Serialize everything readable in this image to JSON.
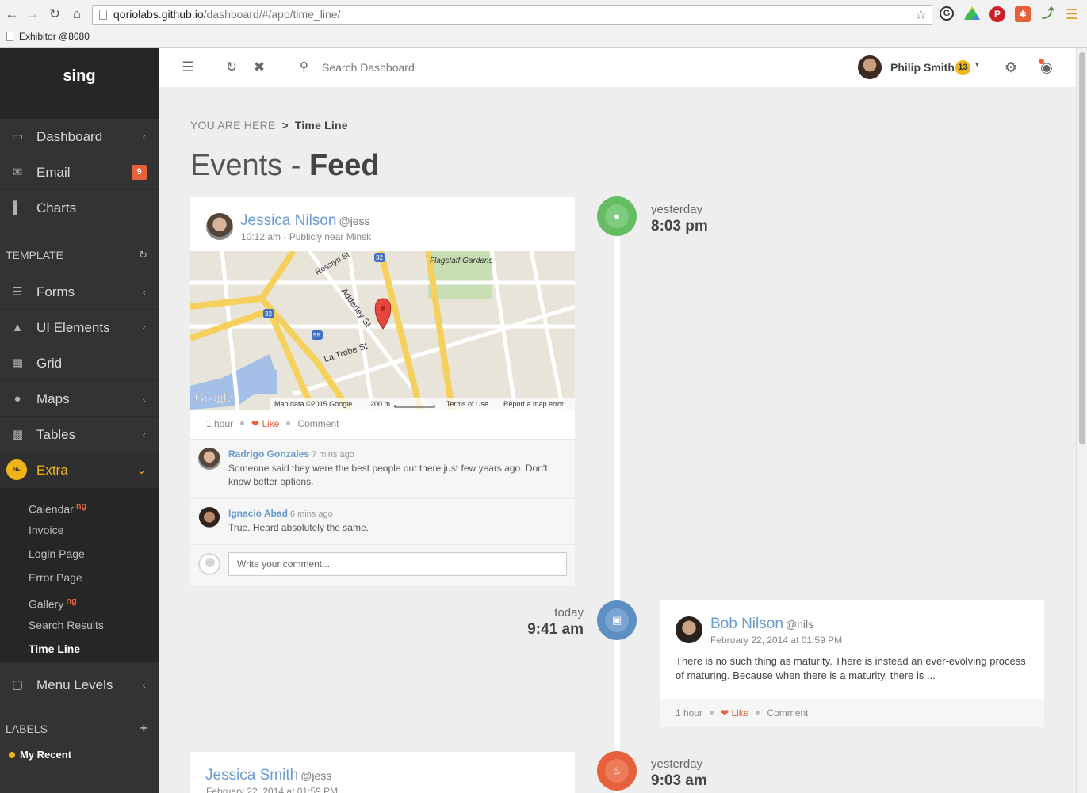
{
  "browser": {
    "url_host": "qoriolabs.github.io",
    "url_path": "/dashboard/#/app/time_line/",
    "bookmark": "Exhibitor @8080"
  },
  "sidebar": {
    "logo": "sing",
    "main_items": [
      {
        "label": "Dashboard",
        "icon": "monitor-icon"
      },
      {
        "label": "Email",
        "icon": "envelope-icon",
        "badge": "9"
      },
      {
        "label": "Charts",
        "icon": "bar-chart-icon"
      }
    ],
    "template_title": "TEMPLATE",
    "template_items": [
      {
        "label": "Forms",
        "icon": "list-icon"
      },
      {
        "label": "UI Elements",
        "icon": "tree-icon"
      },
      {
        "label": "Grid",
        "icon": "grid-icon"
      },
      {
        "label": "Maps",
        "icon": "map-marker-icon"
      },
      {
        "label": "Tables",
        "icon": "table-icon"
      },
      {
        "label": "Extra",
        "icon": "leaf-icon"
      }
    ],
    "extra_sub": [
      {
        "label": "Calendar",
        "tag": "ng"
      },
      {
        "label": "Invoice"
      },
      {
        "label": "Login Page"
      },
      {
        "label": "Error Page"
      },
      {
        "label": "Gallery",
        "tag": "ng"
      },
      {
        "label": "Search Results"
      },
      {
        "label": "Time Line"
      }
    ],
    "menu_levels": "Menu Levels",
    "labels_title": "LABELS",
    "label_items": [
      {
        "label": "My Recent",
        "color": "#f0b518"
      }
    ]
  },
  "topbar": {
    "search_placeholder": "Search Dashboard",
    "user_name": "Philip Smith",
    "user_count": "13"
  },
  "breadcrumb": {
    "prefix": "YOU ARE HERE",
    "sep": ">",
    "current": "Time Line"
  },
  "title": {
    "light": "Events - ",
    "bold": "Feed"
  },
  "events": [
    {
      "when": "yesterday",
      "time": "8:03 pm",
      "icon": "map-marker-icon",
      "color": "#64bd63",
      "author": "Jessica Nilson",
      "handle": "@jess",
      "meta": "10:12 am - Publicly near Minsk",
      "map": {
        "labels": [
          "Flagstaff Gardens",
          "Rosslyn St",
          "Adderley St",
          "La Trobe St",
          "32",
          "32",
          "55"
        ],
        "brand": "Google",
        "attribution": "Map data ©2015 Google",
        "scale": "200 m",
        "terms": "Terms of Use",
        "report": "Report a map error"
      },
      "actions": {
        "age": "1 hour",
        "like": "Like",
        "comment": "Comment"
      },
      "comments": [
        {
          "name": "Radrigo Gonzales",
          "time": "7 mins ago",
          "text": "Someone said they were the best people out there just few years ago. Don't know better options."
        },
        {
          "name": "Ignacio Abad",
          "time": "6 mins ago",
          "text": "True. Heard absolutely the same."
        }
      ],
      "comment_placeholder": "Write your comment..."
    },
    {
      "when": "today",
      "time": "9:41 am",
      "icon": "comment-icon",
      "color": "#5d8fc2",
      "author": "Bob Nilson",
      "handle": "@nils",
      "meta": "February 22, 2014 at 01:59 PM",
      "text": "There is no such thing as maturity. There is instead an ever-evolving process of maturing. Because when there is a maturity, there is ...",
      "actions": {
        "age": "1 hour",
        "like": "Like",
        "comment": "Comment"
      }
    },
    {
      "when": "yesterday",
      "time": "9:03 am",
      "icon": "cutlery-icon",
      "color": "#e5603b",
      "author": "Jessica Smith",
      "handle": "@jess",
      "meta": "February 22, 2014 at 01:59 PM"
    }
  ]
}
